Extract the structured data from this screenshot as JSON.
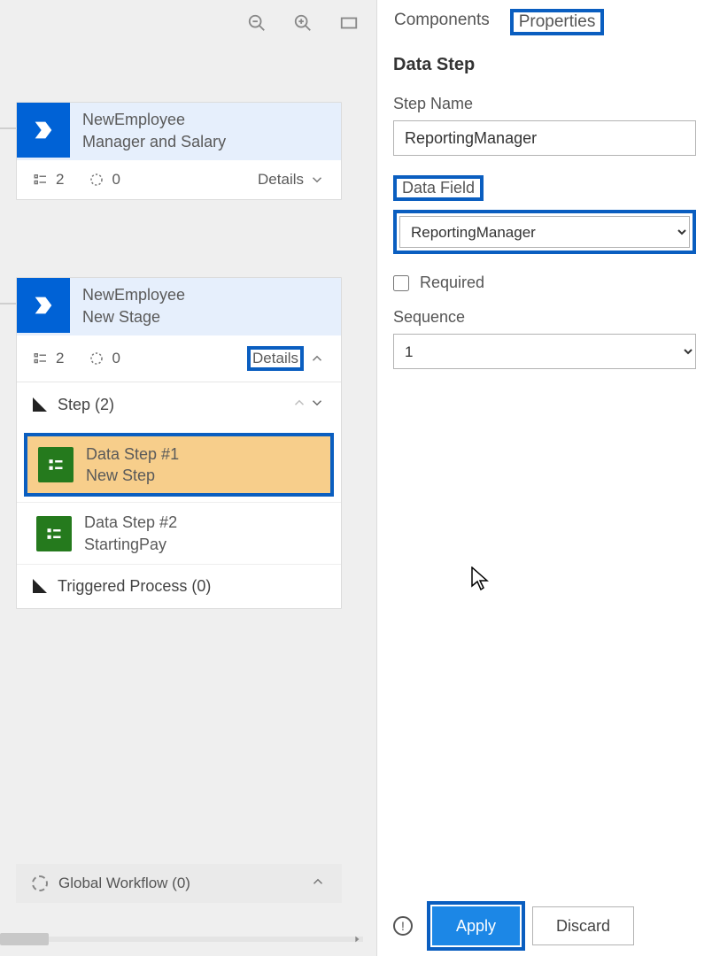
{
  "tabs": {
    "components": "Components",
    "properties": "Properties"
  },
  "panel": {
    "title": "Data Step",
    "stepNameLabel": "Step Name",
    "stepNameValue": "ReportingManager",
    "dataFieldLabel": "Data Field",
    "dataFieldValue": "ReportingManager",
    "requiredLabel": "Required",
    "sequenceLabel": "Sequence",
    "sequenceValue": "1",
    "applyLabel": "Apply",
    "discardLabel": "Discard"
  },
  "stages": [
    {
      "entity": "NewEmployee",
      "name": "Manager and Salary",
      "stepsCount": "2",
      "spinnerCount": "0",
      "detailsLabel": "Details",
      "expanded": false
    },
    {
      "entity": "NewEmployee",
      "name": "New Stage",
      "stepsCount": "2",
      "spinnerCount": "0",
      "detailsLabel": "Details",
      "expanded": true,
      "stepsHeader": "Step (2)",
      "steps": [
        {
          "title": "Data Step #1",
          "sub": "New Step",
          "selected": true
        },
        {
          "title": "Data Step #2",
          "sub": "StartingPay",
          "selected": false
        }
      ],
      "triggered": "Triggered Process (0)"
    }
  ],
  "globalWorkflow": "Global Workflow (0)"
}
